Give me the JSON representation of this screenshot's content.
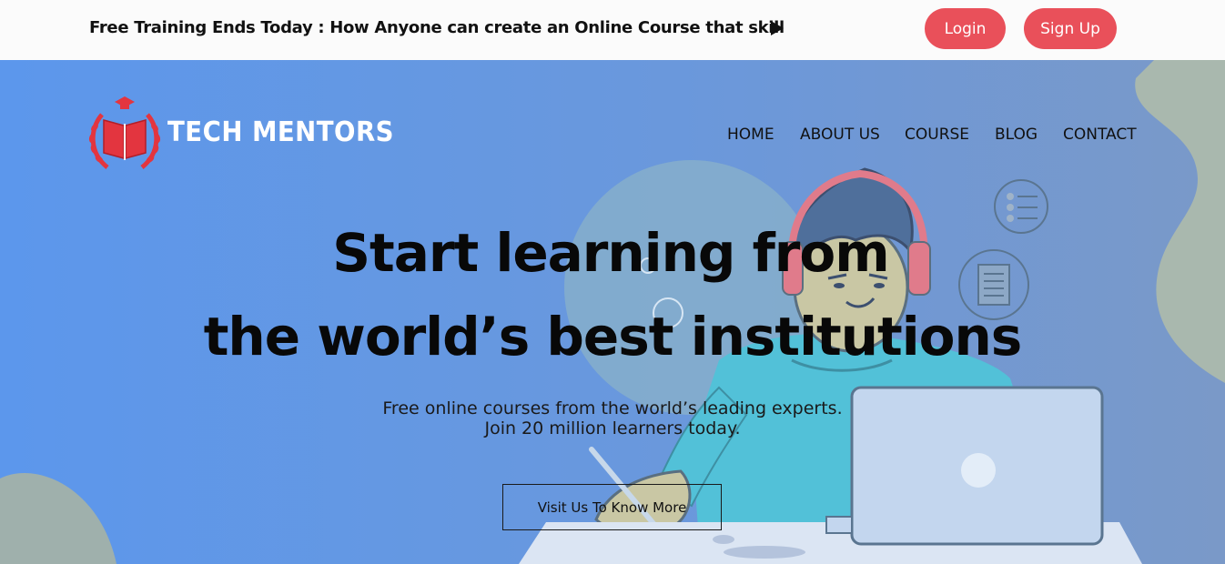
{
  "topbar": {
    "promo_text": "Free Training Ends Today : How Anyone can create an Online Course that skill",
    "play_icon": "play-icon",
    "login_label": "Login",
    "signup_label": "Sign Up"
  },
  "brand": {
    "logo_text": "TECH  MENTORS",
    "emblem_icon": "book-laurel-emblem"
  },
  "nav": {
    "items": [
      "HOME",
      "ABOUT US",
      "COURSE",
      "BLOG",
      "CONTACT"
    ]
  },
  "hero": {
    "headline_line1": "Start learning from",
    "headline_line2": "the world’s best institutions",
    "subtitle_line1": "Free online courses from the world’s leading experts.",
    "subtitle_line2": "Join 20 million learners today.",
    "cta_label": "Visit Us To Know More"
  },
  "colors": {
    "accent": "#e9505a",
    "hero_start": "#5c97ec",
    "hero_end": "#7a99c8",
    "text_dark": "#111111"
  }
}
